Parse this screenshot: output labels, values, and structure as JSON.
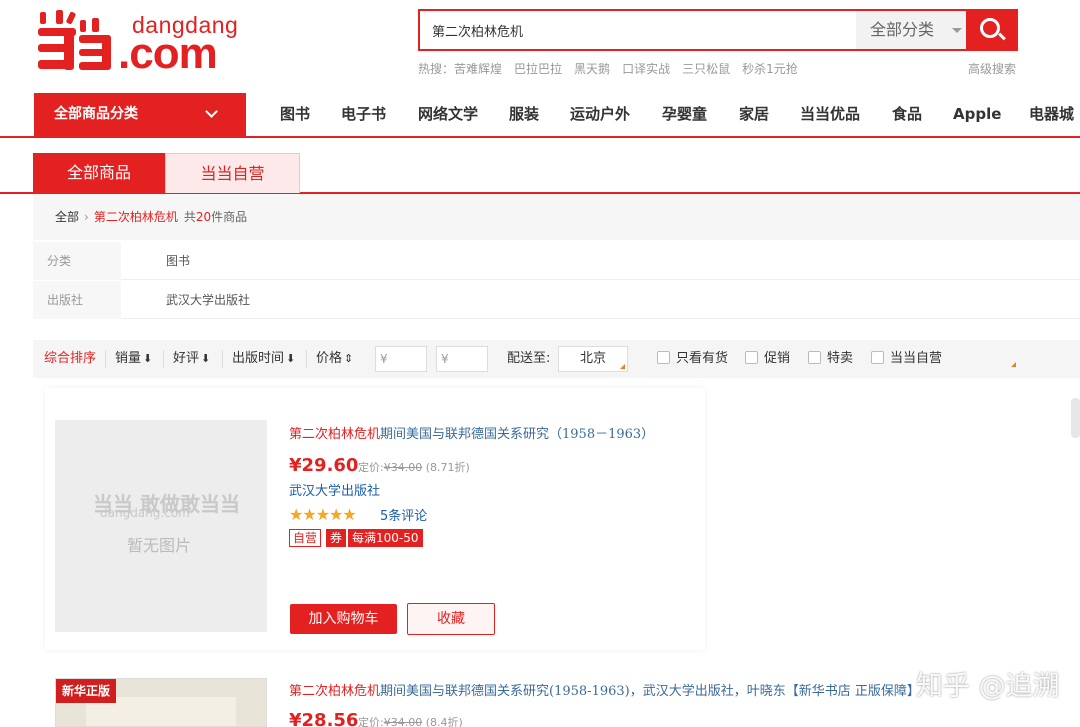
{
  "header": {
    "logo_text_top": "dangdang",
    "logo_text_bottom": ".com",
    "search": {
      "value": "第二次柏林危机",
      "category": "全部分类"
    },
    "hot_search_label": "热搜：",
    "hot_searches": [
      "苦难辉煌",
      "巴拉巴拉",
      "黑天鹅",
      "口译实战",
      "三只松鼠",
      "秒杀1元抢"
    ],
    "advanced_search": "高级搜索"
  },
  "nav": {
    "all_categories": "全部商品分类",
    "items": [
      "图书",
      "电子书",
      "网络文学",
      "服装",
      "运动户外",
      "孕婴童",
      "家居",
      "当当优品",
      "食品",
      "Apple",
      "电器城"
    ]
  },
  "tabs": [
    "全部商品",
    "当当自营"
  ],
  "breadcrumb": {
    "root": "全部",
    "keyword": "第二次柏林危机",
    "count_prefix": "共",
    "count": "20",
    "count_suffix": "件商品"
  },
  "filters": [
    {
      "label": "分类",
      "value": "图书"
    },
    {
      "label": "出版社",
      "value": "武汉大学出版社"
    }
  ],
  "sort": {
    "comprehensive": "综合排序",
    "sales": "销量",
    "rating": "好评",
    "publish_time": "出版时间",
    "price": "价格",
    "price_min_placeholder": "¥",
    "price_max_placeholder": "¥",
    "ship_to_label": "配送至:",
    "city": "北京",
    "checkboxes": [
      "只看有货",
      "促销",
      "特卖",
      "当当自营"
    ]
  },
  "products": [
    {
      "title_kw": "第二次柏林危机",
      "title_rest": "期间美国与联邦德国关系研究（1958－1963）",
      "price": "¥29.60",
      "orig_label": "定价:",
      "orig_price": "¥34.00",
      "discount": "(8.71折)",
      "publisher": "武汉大学出版社",
      "stars": "★★★★★",
      "reviews": "5条评论",
      "tags": [
        "自营",
        "券",
        "每满100-50"
      ],
      "cart_button": "加入购物车",
      "fav_button": "收藏",
      "no_image_brand": "当当 敢做敢当当",
      "no_image_domain": "dangdang.com",
      "no_image_text": "暂无图片"
    },
    {
      "title_kw": "第二次柏林危机",
      "title_rest": "期间美国与联邦德国关系研究(1958-1963)，武汉大学出版社，叶晓东【新华书店 正版保障】",
      "price": "¥28.56",
      "orig_label": "定价:",
      "orig_price": "¥34.00",
      "discount": "(8.4折)",
      "ribbon": "新华正版"
    }
  ],
  "watermark": "知乎 @追溯",
  "colors": {
    "brand_red": "#e32121",
    "link_blue": "#1a5eab",
    "star": "#f5a623"
  }
}
